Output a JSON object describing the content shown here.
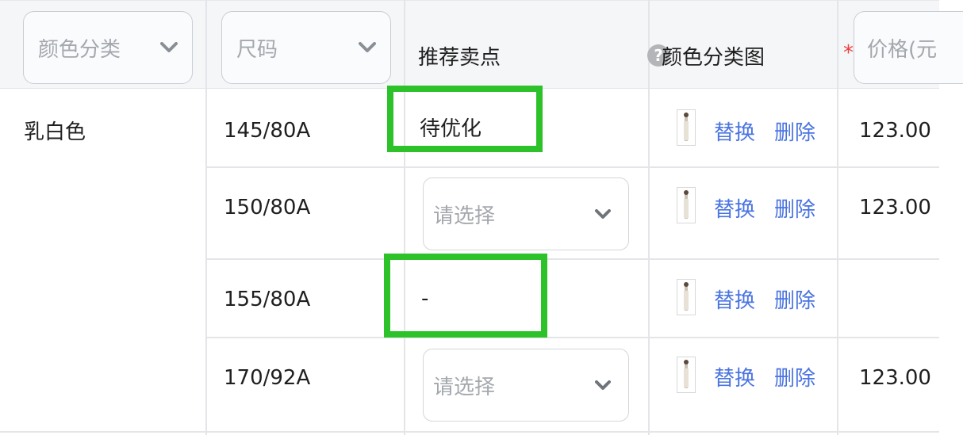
{
  "header": {
    "color_category_select": "颜色分类",
    "size_select": "尺码",
    "selling_point": "推荐卖点",
    "help_symbol": "?",
    "color_image": "颜色分类图",
    "required_star": "*",
    "price_select": "价格(元"
  },
  "color_group": "乳白色",
  "rows": [
    {
      "size": "145/80A",
      "selling_point": "待优化",
      "replace": "替换",
      "delete": "删除",
      "price": "123.00"
    },
    {
      "size": "150/80A",
      "selling_point_placeholder": "请选择",
      "replace": "替换",
      "delete": "删除",
      "price": "123.00"
    },
    {
      "size": "155/80A",
      "selling_point": "-",
      "replace": "替换",
      "delete": "删除",
      "price": ""
    },
    {
      "size": "170/92A",
      "selling_point_placeholder": "请选择",
      "replace": "替换",
      "delete": "删除",
      "price": "123.00"
    }
  ],
  "colors": {
    "link": "#4a74e0",
    "highlight": "#2ec22a",
    "required": "#f03d3d"
  },
  "icons": [
    "chevron-down-icon",
    "help-icon",
    "product-thumbnail"
  ]
}
